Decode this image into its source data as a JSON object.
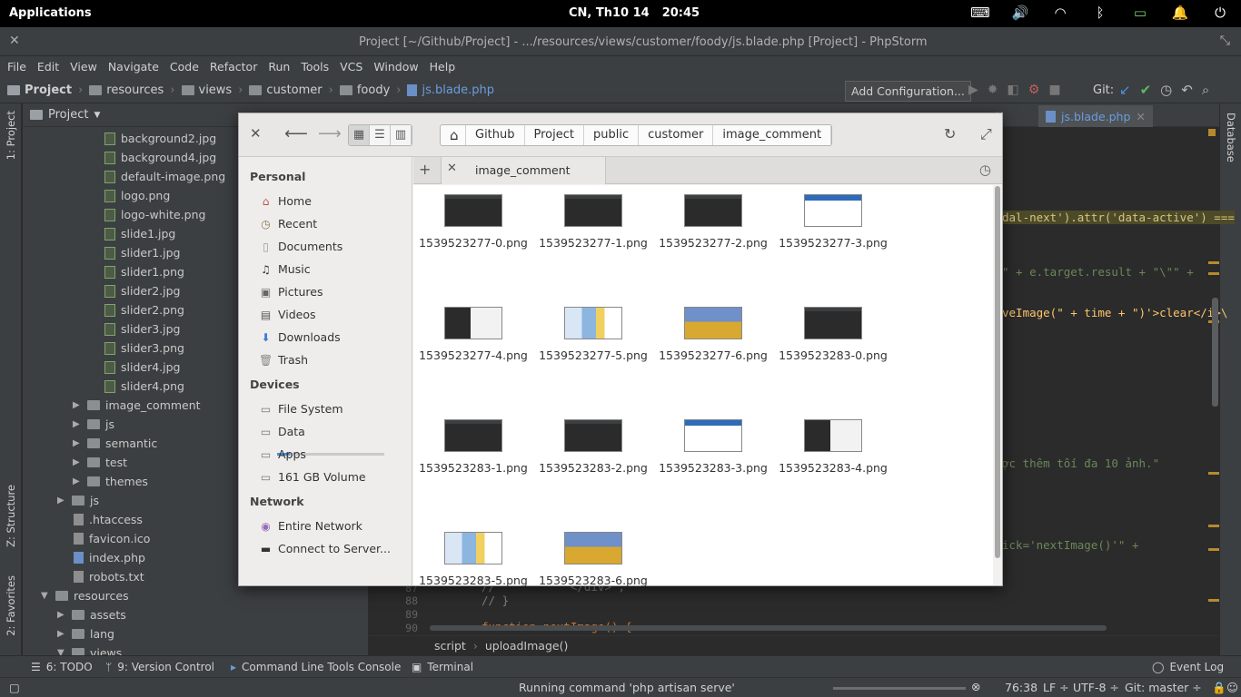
{
  "system_bar": {
    "apps": "Applications",
    "date": "CN, Th10 14",
    "time": "20:45"
  },
  "window": {
    "title": "Project [~/Github/Project] - .../resources/views/customer/foody/js.blade.php [Project] - PhpStorm"
  },
  "menu": [
    "File",
    "Edit",
    "View",
    "Navigate",
    "Code",
    "Refactor",
    "Run",
    "Tools",
    "VCS",
    "Window",
    "Help"
  ],
  "nav": {
    "crumbs": [
      "Project",
      "resources",
      "views",
      "customer",
      "foody",
      "js.blade.php"
    ],
    "add_config": "Add Configuration...",
    "git_label": "Git:"
  },
  "left_strip": {
    "project": "1: Project",
    "structure": "Z: Structure",
    "favorites": "2: Favorites"
  },
  "right_strip": {
    "database": "Database"
  },
  "project_panel": {
    "header": "Project",
    "rows": [
      {
        "label": "background2.jpg",
        "kind": "img"
      },
      {
        "label": "background4.jpg",
        "kind": "img"
      },
      {
        "label": "default-image.png",
        "kind": "img"
      },
      {
        "label": "logo.png",
        "kind": "img"
      },
      {
        "label": "logo-white.png",
        "kind": "img"
      },
      {
        "label": "slide1.jpg",
        "kind": "img"
      },
      {
        "label": "slider1.jpg",
        "kind": "img"
      },
      {
        "label": "slider1.png",
        "kind": "img"
      },
      {
        "label": "slider2.jpg",
        "kind": "img"
      },
      {
        "label": "slider2.png",
        "kind": "img"
      },
      {
        "label": "slider3.jpg",
        "kind": "img"
      },
      {
        "label": "slider3.png",
        "kind": "img"
      },
      {
        "label": "slider4.jpg",
        "kind": "img"
      },
      {
        "label": "slider4.png",
        "kind": "img"
      },
      {
        "label": "image_comment",
        "kind": "folder"
      },
      {
        "label": "js",
        "kind": "folder"
      },
      {
        "label": "semantic",
        "kind": "folder"
      },
      {
        "label": "test",
        "kind": "folder"
      },
      {
        "label": "themes",
        "kind": "folder"
      },
      {
        "label": "js",
        "kind": "folder"
      },
      {
        "label": ".htaccess",
        "kind": "file"
      },
      {
        "label": "favicon.ico",
        "kind": "file"
      },
      {
        "label": "index.php",
        "kind": "php"
      },
      {
        "label": "robots.txt",
        "kind": "file"
      },
      {
        "label": "resources",
        "kind": "folder"
      },
      {
        "label": "assets",
        "kind": "folder"
      },
      {
        "label": "lang",
        "kind": "folder"
      },
      {
        "label": "views",
        "kind": "folder"
      }
    ]
  },
  "editor": {
    "active_tab": "js.blade.php",
    "code_lines": {
      "l1": "dal-next').attr('data-active') ===",
      "l2": "\" + e.target.result + \"\\\"\" +",
      "l3": "veImage(\" + time + \")'>clear</i>\\",
      "l4": "ợc thêm tối đa 10 ảnh.\"",
      "l5": "ick='nextImage()'\" +",
      "l6": "//           </div>\";",
      "l7": "// }",
      "l8": "function nextImage() {"
    },
    "line_numbers": [
      "87",
      "88",
      "89",
      "90"
    ],
    "breadcrumb": [
      "script",
      "uploadImage()"
    ]
  },
  "toolbar": {
    "todo": "6: TODO",
    "vcs": "9: Version Control",
    "cmdline": "Command Line Tools Console",
    "terminal": "Terminal",
    "eventlog": "Event Log"
  },
  "status": {
    "running": "Running command 'php artisan serve'",
    "position": "76:38",
    "line_sep": "LF ÷",
    "encoding": "UTF-8 ÷",
    "git_branch": "Git: master ÷"
  },
  "file_manager": {
    "path": [
      "Github",
      "Project",
      "public",
      "customer",
      "image_comment"
    ],
    "tab_label": "image_comment",
    "sidebar": {
      "personal_heading": "Personal",
      "personal": [
        {
          "label": "Home",
          "icon": "home-icon"
        },
        {
          "label": "Recent",
          "icon": "recent-icon"
        },
        {
          "label": "Documents",
          "icon": "documents-icon"
        },
        {
          "label": "Music",
          "icon": "music-icon"
        },
        {
          "label": "Pictures",
          "icon": "pictures-icon"
        },
        {
          "label": "Videos",
          "icon": "videos-icon"
        },
        {
          "label": "Downloads",
          "icon": "downloads-icon"
        },
        {
          "label": "Trash",
          "icon": "trash-icon"
        }
      ],
      "devices_heading": "Devices",
      "devices": [
        {
          "label": "File System"
        },
        {
          "label": "Data"
        },
        {
          "label": "Apps"
        },
        {
          "label": "161 GB Volume"
        }
      ],
      "network_heading": "Network",
      "network": [
        {
          "label": "Entire Network"
        },
        {
          "label": "Connect to Server..."
        }
      ]
    },
    "files": [
      {
        "name": "1539523277-0.png",
        "thumb": "dark"
      },
      {
        "name": "1539523277-1.png",
        "thumb": "dark"
      },
      {
        "name": "1539523277-2.png",
        "thumb": "dark"
      },
      {
        "name": "1539523277-3.png",
        "thumb": "white"
      },
      {
        "name": "1539523277-4.png",
        "thumb": "mixed"
      },
      {
        "name": "1539523277-5.png",
        "thumb": "collage"
      },
      {
        "name": "1539523277-6.png",
        "thumb": "anime"
      },
      {
        "name": "1539523283-0.png",
        "thumb": "dark"
      },
      {
        "name": "1539523283-1.png",
        "thumb": "dark"
      },
      {
        "name": "1539523283-2.png",
        "thumb": "dark"
      },
      {
        "name": "1539523283-3.png",
        "thumb": "white"
      },
      {
        "name": "1539523283-4.png",
        "thumb": "mixed"
      },
      {
        "name": "1539523283-5.png",
        "thumb": "collage"
      },
      {
        "name": "1539523283-6.png",
        "thumb": "anime"
      }
    ]
  }
}
